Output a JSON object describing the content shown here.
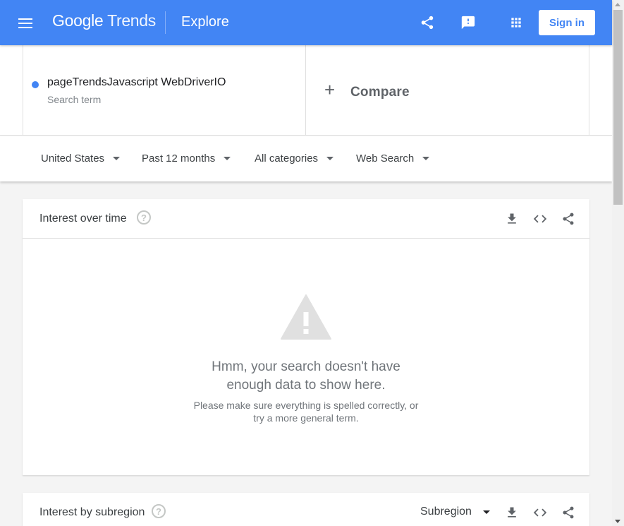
{
  "header": {
    "logo_google": "Google",
    "logo_trends": "Trends",
    "page_title": "Explore",
    "signin_label": "Sign in",
    "icons": [
      "menu-icon",
      "share-icon",
      "feedback-icon",
      "apps-icon"
    ]
  },
  "search_terms": {
    "term": {
      "name": "pageTrendsJavascript WebDriverIO",
      "type": "Search term",
      "color": "#4285f4"
    },
    "compare_label": "Compare"
  },
  "filters": {
    "region": "United States",
    "time_range": "Past 12 months",
    "category": "All categories",
    "search_type": "Web Search"
  },
  "interest_over_time": {
    "title": "Interest over time",
    "message_line1": "Hmm, your search doesn't have",
    "message_line2": "enough data to show here.",
    "hint_line1": "Please make sure everything is spelled correctly, or",
    "hint_line2": "try a more general term."
  },
  "interest_by_subregion": {
    "title": "Interest by subregion",
    "resolution_select": "Subregion"
  },
  "colors": {
    "brand_blue": "#4285f4",
    "page_bg": "#f4f4f4"
  }
}
